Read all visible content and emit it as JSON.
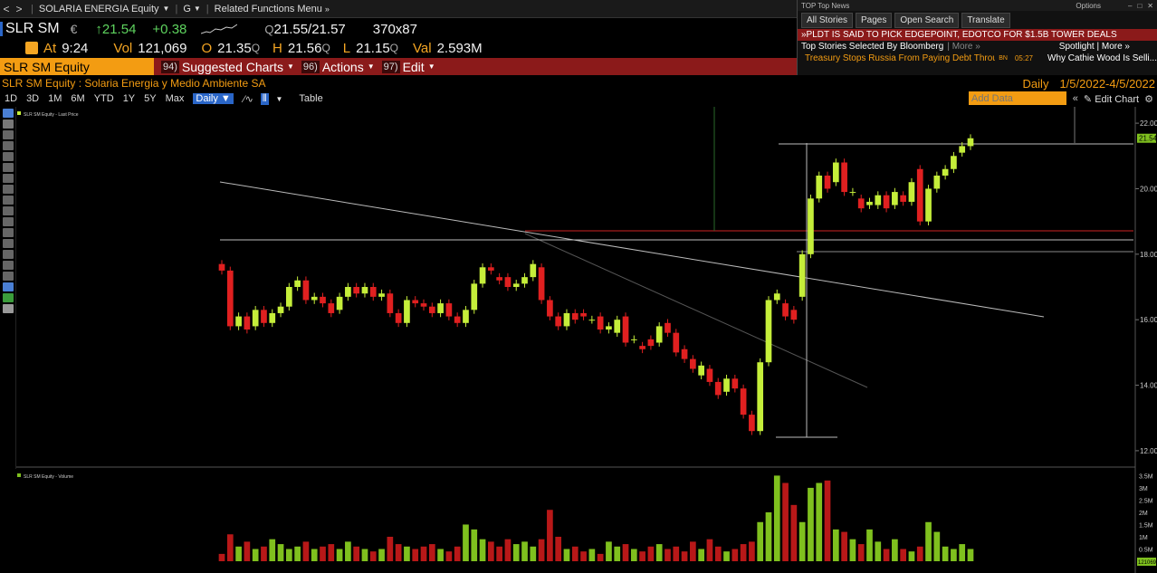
{
  "cmdbar": {
    "back": "<",
    "forward": ">",
    "security": "SOLARIA ENERGIA Equity",
    "g": "G",
    "related": "Related Functions Menu"
  },
  "quote": {
    "ticker": "SLR SM",
    "currency": "€",
    "last": "↑21.54",
    "change": "+0.38",
    "bidask": "21.55/21.57",
    "bidask_q": "Q",
    "size": "370x87",
    "at_label": "At",
    "time": "9:24",
    "vol_label": "Vol",
    "vol": "121,069",
    "open_label": "O",
    "open": "21.35",
    "high_label": "H",
    "high": "21.56",
    "low_label": "L",
    "low": "21.15",
    "val_label": "Val",
    "val": "2.593M",
    "q": "Q"
  },
  "secbar": {
    "ticker": "SLR SM Equity",
    "menu1_num": "94)",
    "menu1": "Suggested Charts",
    "menu2_num": "96)",
    "menu2": "Actions",
    "menu3_num": "97)",
    "menu3": "Edit"
  },
  "news": {
    "title": "TOP Top News",
    "options": "Options",
    "tabs": [
      "All Stories",
      "Pages",
      "Open Search",
      "Translate"
    ],
    "headline": "»PLDT IS SAID TO PICK EDGEPOINT, EDOTCO FOR $1.5B TOWER DEALS",
    "top_stories": "Top Stories Selected By Bloomberg",
    "more": "| More »",
    "spotlight": "Spotlight | More »",
    "story": "Treasury Stops Russia From Paying Debt Through Its U.S. Accou...",
    "story_src": "BN",
    "story_time": "05:27",
    "story2": "Why Cathie Wood Is Selli..."
  },
  "name": {
    "full": "SLR SM Equity : Solaria Energia y Medio Ambiente SA",
    "freq": "Daily",
    "daterange": "1/5/2022-4/5/2022"
  },
  "toolbar": {
    "ranges": [
      "1D",
      "3D",
      "1M",
      "6M",
      "YTD",
      "1Y",
      "5Y",
      "Max"
    ],
    "period": "Daily",
    "table": "Table",
    "add_data_placeholder": "Add Data",
    "edit_chart": "Edit Chart"
  },
  "colors": {
    "up": "#c5ee3a",
    "down": "#e02020",
    "volume_up": "#7fc01e",
    "volume_down": "#b81818",
    "accent": "#f39c12",
    "bar": "#8b1a1a"
  },
  "chart_data": {
    "type": "candlestick",
    "price_legend": "SLR SM Equity - Last Price",
    "volume_legend": "SLR SM Equity - Volume",
    "price_ylim": [
      11.5,
      22.5
    ],
    "price_ticks": [
      "22.00",
      "20.00",
      "18.00",
      "16.00",
      "14.00",
      "12.00"
    ],
    "last_price_label": "21.54",
    "volume_ticks": [
      "3.5M",
      "3M",
      "2.5M",
      "2M",
      "1.5M",
      "1M",
      "0.5M"
    ],
    "last_volume_label": "121069",
    "candles": [
      [
        17.7,
        17.5
      ],
      [
        17.5,
        15.8
      ],
      [
        15.8,
        16.1
      ],
      [
        16.1,
        15.7
      ],
      [
        15.8,
        16.3
      ],
      [
        16.3,
        15.9
      ],
      [
        15.9,
        16.2
      ],
      [
        16.2,
        16.4
      ],
      [
        16.4,
        17.0
      ],
      [
        17.0,
        17.2
      ],
      [
        17.2,
        16.6
      ],
      [
        16.6,
        16.7
      ],
      [
        16.7,
        16.5
      ],
      [
        16.5,
        16.2
      ],
      [
        16.3,
        16.7
      ],
      [
        16.7,
        17.0
      ],
      [
        17.0,
        16.8
      ],
      [
        16.8,
        17.0
      ],
      [
        17.0,
        16.7
      ],
      [
        16.7,
        16.8
      ],
      [
        16.8,
        16.2
      ],
      [
        16.2,
        15.9
      ],
      [
        15.9,
        16.6
      ],
      [
        16.6,
        16.5
      ],
      [
        16.5,
        16.4
      ],
      [
        16.4,
        16.2
      ],
      [
        16.2,
        16.5
      ],
      [
        16.5,
        16.1
      ],
      [
        16.1,
        15.9
      ],
      [
        15.9,
        16.3
      ],
      [
        16.3,
        17.1
      ],
      [
        17.1,
        17.6
      ],
      [
        17.6,
        17.5
      ],
      [
        17.3,
        17.2
      ],
      [
        17.3,
        17.0
      ],
      [
        17.0,
        17.1
      ],
      [
        17.1,
        17.3
      ],
      [
        17.3,
        17.7
      ],
      [
        17.6,
        16.6
      ],
      [
        16.6,
        16.1
      ],
      [
        16.1,
        15.8
      ],
      [
        15.8,
        16.2
      ],
      [
        16.2,
        16.0
      ],
      [
        16.2,
        16.1
      ],
      [
        16.0,
        16.0
      ],
      [
        16.1,
        15.7
      ],
      [
        15.7,
        15.8
      ],
      [
        15.6,
        16.0
      ],
      [
        16.1,
        15.3
      ],
      [
        15.4,
        15.4
      ],
      [
        15.2,
        15.1
      ],
      [
        15.4,
        15.2
      ],
      [
        15.3,
        15.8
      ],
      [
        15.9,
        15.6
      ],
      [
        15.6,
        15.0
      ],
      [
        15.1,
        14.8
      ],
      [
        14.8,
        14.5
      ],
      [
        14.3,
        14.6
      ],
      [
        14.5,
        14.1
      ],
      [
        14.1,
        13.7
      ],
      [
        13.8,
        14.2
      ],
      [
        14.2,
        13.9
      ],
      [
        13.9,
        13.1
      ],
      [
        13.1,
        12.6
      ],
      [
        12.6,
        14.7
      ],
      [
        14.7,
        16.6
      ],
      [
        16.6,
        16.8
      ],
      [
        16.5,
        16.1
      ],
      [
        16.3,
        16.0
      ],
      [
        16.7,
        18.0
      ],
      [
        18.0,
        19.7
      ],
      [
        19.7,
        20.4
      ],
      [
        20.4,
        20.0
      ],
      [
        20.2,
        20.8
      ],
      [
        20.8,
        19.9
      ],
      [
        19.9,
        19.9
      ],
      [
        19.7,
        19.4
      ],
      [
        19.5,
        19.6
      ],
      [
        19.5,
        19.8
      ],
      [
        19.8,
        19.4
      ],
      [
        19.5,
        19.9
      ],
      [
        19.8,
        19.6
      ],
      [
        19.6,
        20.2
      ],
      [
        20.6,
        19.0
      ],
      [
        19.0,
        20.0
      ],
      [
        20.0,
        20.4
      ],
      [
        20.4,
        20.6
      ],
      [
        20.6,
        21.0
      ],
      [
        21.1,
        21.3
      ],
      [
        21.3,
        21.54
      ]
    ],
    "volumes": [
      0.3,
      1.1,
      0.6,
      0.8,
      0.5,
      0.6,
      0.9,
      0.7,
      0.5,
      0.6,
      0.8,
      0.5,
      0.6,
      0.7,
      0.5,
      0.8,
      0.6,
      0.5,
      0.4,
      0.5,
      1.0,
      0.7,
      0.6,
      0.5,
      0.6,
      0.7,
      0.5,
      0.4,
      0.6,
      1.5,
      1.3,
      0.9,
      0.8,
      0.6,
      0.9,
      0.7,
      0.8,
      0.6,
      0.9,
      2.1,
      1.0,
      0.5,
      0.6,
      0.4,
      0.5,
      0.3,
      0.8,
      0.6,
      0.7,
      0.5,
      0.4,
      0.6,
      0.7,
      0.5,
      0.6,
      0.4,
      0.8,
      0.5,
      0.9,
      0.6,
      0.4,
      0.5,
      0.7,
      0.8,
      1.6,
      2.0,
      3.5,
      3.2,
      2.3,
      1.6,
      3.0,
      3.2,
      3.3,
      1.3,
      1.2,
      0.9,
      0.7,
      1.3,
      0.8,
      0.5,
      0.9,
      0.5,
      0.4,
      0.6,
      1.6,
      1.2,
      0.6,
      0.5,
      0.7,
      0.5
    ]
  }
}
